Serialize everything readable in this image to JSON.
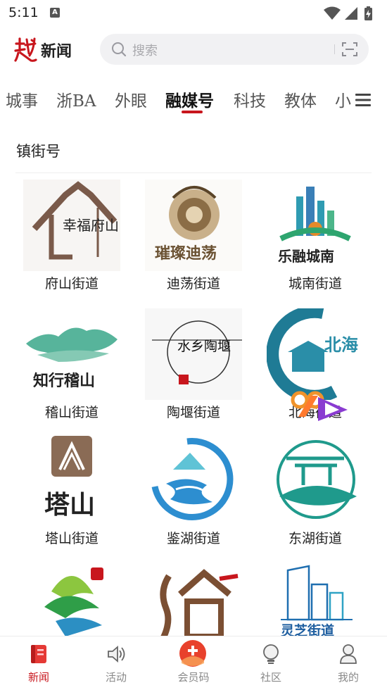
{
  "status": {
    "time": "5:11",
    "notification_letter": "A"
  },
  "header": {
    "brand": "新闻",
    "search_placeholder": "搜索"
  },
  "tabs": [
    {
      "label": "城事"
    },
    {
      "label": "浙BA"
    },
    {
      "label": "外眼"
    },
    {
      "label": "融媒号",
      "active": true
    },
    {
      "label": "科技"
    },
    {
      "label": "教体"
    },
    {
      "label": "小"
    }
  ],
  "section": {
    "title": "镇街号"
  },
  "grid": [
    {
      "label": "府山街道",
      "logo_text": "幸福府山"
    },
    {
      "label": "迪荡街道",
      "logo_text": "璀璨迪荡"
    },
    {
      "label": "城南街道",
      "logo_text": "乐融城南"
    },
    {
      "label": "稽山街道",
      "logo_text": "知行稽山"
    },
    {
      "label": "陶堰街道",
      "logo_text": "水乡陶堰"
    },
    {
      "label": "北海街道",
      "logo_text": "北海"
    },
    {
      "label": "塔山街道",
      "logo_text": "塔山"
    },
    {
      "label": "鉴湖街道",
      "logo_text": ""
    },
    {
      "label": "东湖街道",
      "logo_text": ""
    },
    {
      "label": "",
      "logo_text": ""
    },
    {
      "label": "",
      "logo_text": ""
    },
    {
      "label": "",
      "logo_text": "灵芝街道"
    }
  ],
  "bottom_nav": [
    {
      "label": "新闻",
      "icon": "news-icon",
      "active": true
    },
    {
      "label": "活动",
      "icon": "speaker-icon"
    },
    {
      "label": "会员码",
      "icon": "member-plus-icon"
    },
    {
      "label": "社区",
      "icon": "bulb-icon"
    },
    {
      "label": "我的",
      "icon": "profile-icon"
    }
  ],
  "colors": {
    "brand_red": "#c8161d",
    "text": "#222222",
    "muted": "#8a8a8a"
  }
}
